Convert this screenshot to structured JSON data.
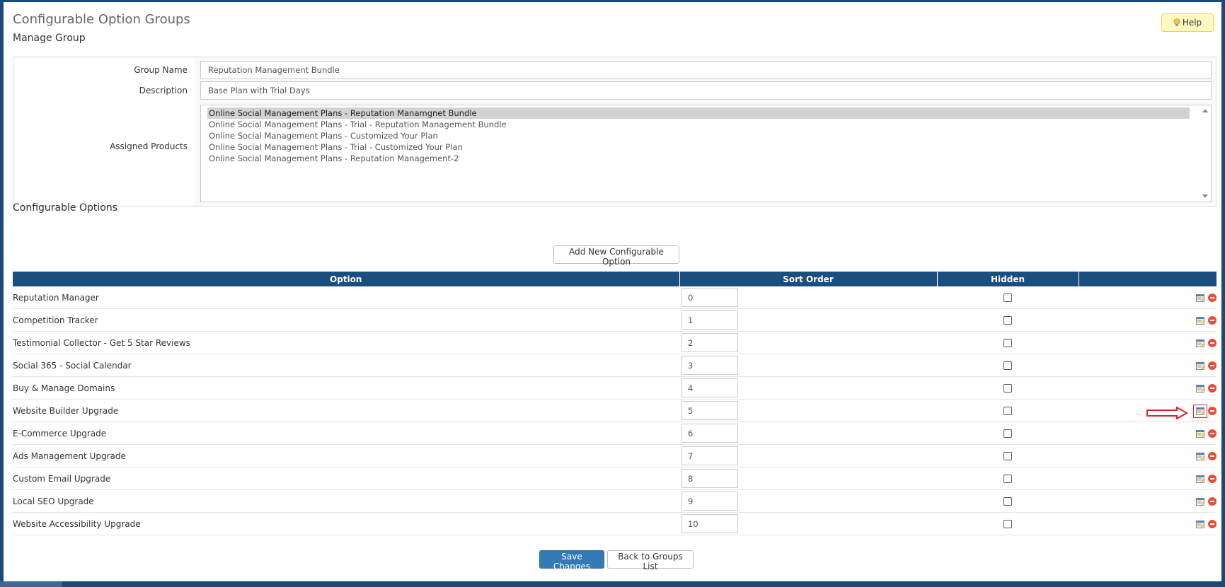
{
  "page": {
    "title": "Configurable Option Groups",
    "help_label": "Help"
  },
  "manage_group": {
    "heading": "Manage Group",
    "group_name_label": "Group Name",
    "group_name_value": "Reputation Management Bundle",
    "description_label": "Description",
    "description_value": "Base Plan with Trial Days",
    "assigned_products_label": "Assigned Products",
    "assigned_products": [
      {
        "label": "Online Social Management Plans - Reputation Manamgnet Bundle",
        "selected": true
      },
      {
        "label": "Online Social Management Plans - Trial - Reputation Management Bundle",
        "selected": false
      },
      {
        "label": "Online Social Management Plans - Customized Your Plan",
        "selected": false
      },
      {
        "label": "Online Social Management Plans - Trial - Customized Your Plan",
        "selected": false
      },
      {
        "label": "Online Social Management Plans - Reputation Management-2",
        "selected": false
      }
    ]
  },
  "configurable_options": {
    "heading": "Configurable Options",
    "add_button_label": "Add New Configurable Option",
    "columns": {
      "option": "Option",
      "sort_order": "Sort Order",
      "hidden": "Hidden"
    },
    "rows": [
      {
        "option": "Reputation Manager",
        "sort_order": "0",
        "hidden": false
      },
      {
        "option": "Competition Tracker",
        "sort_order": "1",
        "hidden": false
      },
      {
        "option": "Testimonial Collector - Get 5 Star Reviews",
        "sort_order": "2",
        "hidden": false
      },
      {
        "option": "Social 365 - Social Calendar",
        "sort_order": "3",
        "hidden": false
      },
      {
        "option": "Buy & Manage Domains",
        "sort_order": "4",
        "hidden": false
      },
      {
        "option": "Website Builder Upgrade",
        "sort_order": "5",
        "hidden": false,
        "highlighted": true
      },
      {
        "option": "E-Commerce Upgrade",
        "sort_order": "6",
        "hidden": false
      },
      {
        "option": "Ads Management Upgrade",
        "sort_order": "7",
        "hidden": false
      },
      {
        "option": "Custom Email Upgrade",
        "sort_order": "8",
        "hidden": false
      },
      {
        "option": "Local SEO Upgrade",
        "sort_order": "9",
        "hidden": false
      },
      {
        "option": "Website Accessibility Upgrade",
        "sort_order": "10",
        "hidden": false
      }
    ]
  },
  "footer": {
    "save_label": "Save Changes",
    "back_label": "Back to Groups List"
  },
  "colors": {
    "header_bg": "#1a4e7e",
    "primary_button": "#337ab7",
    "help_bg": "#fff9c4",
    "annotation_red": "#e0232a",
    "delete_red": "#e74c3c"
  },
  "icons": {
    "help": "lightbulb-icon",
    "edit": "edit-icon",
    "delete": "delete-icon",
    "annotation": "red-arrow-annotation"
  }
}
